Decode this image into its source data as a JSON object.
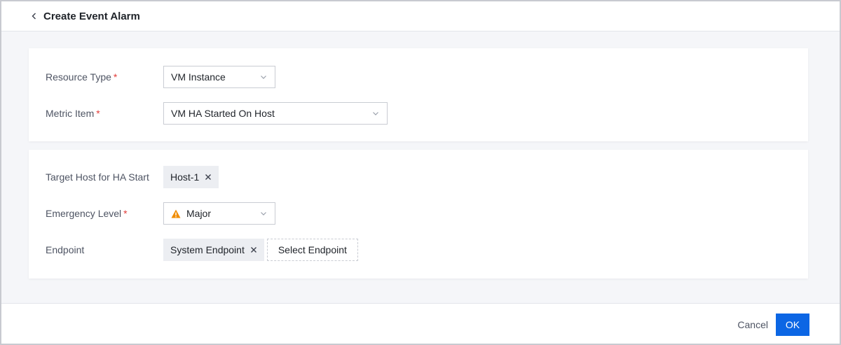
{
  "header": {
    "title": "Create Event Alarm",
    "back_icon": "chevron-left-icon"
  },
  "form": {
    "resource_type": {
      "label": "Resource Type",
      "required_mark": "*",
      "value": "VM Instance"
    },
    "metric_item": {
      "label": "Metric Item",
      "required_mark": "*",
      "value": "VM HA Started On Host"
    },
    "target_host": {
      "label": "Target Host for HA Start",
      "tags": [
        "Host-1"
      ]
    },
    "emergency_level": {
      "label": "Emergency Level",
      "required_mark": "*",
      "value": "Major",
      "icon": "warning-triangle-icon",
      "icon_color": "#f08c00"
    },
    "endpoint": {
      "label": "Endpoint",
      "tags": [
        "System Endpoint"
      ],
      "select_label": "Select Endpoint"
    }
  },
  "footer": {
    "cancel_label": "Cancel",
    "ok_label": "OK"
  },
  "colors": {
    "primary": "#0c66e4",
    "required": "#e23c39",
    "background": "#f5f6f9"
  }
}
